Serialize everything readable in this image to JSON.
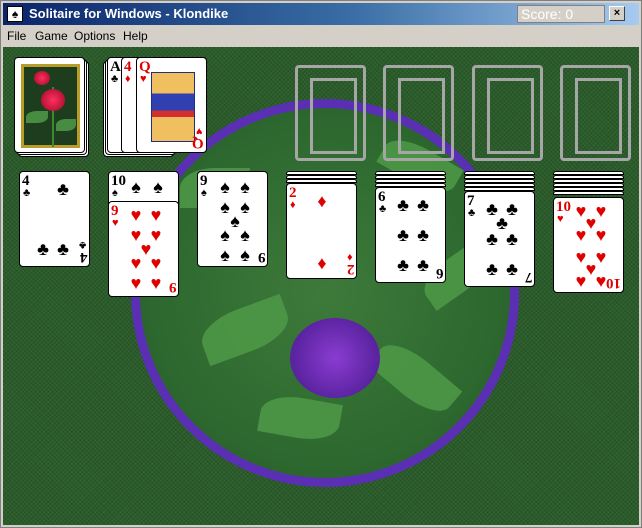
{
  "window": {
    "title": "Solitaire for Windows - Klondike",
    "score_label": "Score: 0",
    "close_glyph": "×"
  },
  "menu": [
    "File",
    "Game",
    "Options",
    "Help"
  ],
  "waste": [
    {
      "rank": "A",
      "suit": "♣",
      "color": "black"
    },
    {
      "rank": "4",
      "suit": "♦",
      "color": "red"
    },
    {
      "rank": "Q",
      "suit": "♥",
      "color": "red"
    }
  ],
  "tableau": [
    {
      "top": {
        "rank": "4",
        "suit": "♣",
        "color": "black"
      },
      "beneath": []
    },
    {
      "top": {
        "rank": "9",
        "suit": "♥",
        "color": "red"
      },
      "beneath": [
        {
          "rank": "10",
          "suit": "♠",
          "color": "black"
        }
      ]
    },
    {
      "top": {
        "rank": "9",
        "suit": "♠",
        "color": "black"
      },
      "beneath": []
    },
    {
      "top": {
        "rank": "2",
        "suit": "♦",
        "color": "red"
      },
      "beneath": []
    },
    {
      "top": {
        "rank": "6",
        "suit": "♣",
        "color": "black"
      },
      "beneath": []
    },
    {
      "top": {
        "rank": "7",
        "suit": "♣",
        "color": "black"
      },
      "beneath": []
    },
    {
      "top": {
        "rank": "10",
        "suit": "♥",
        "color": "red"
      },
      "beneath": []
    }
  ],
  "colors": {
    "felt": "#2a5c2a",
    "title_start": "#0a246a",
    "red_suit": "#e00000",
    "medallion_ring": "#5a2fb4"
  }
}
